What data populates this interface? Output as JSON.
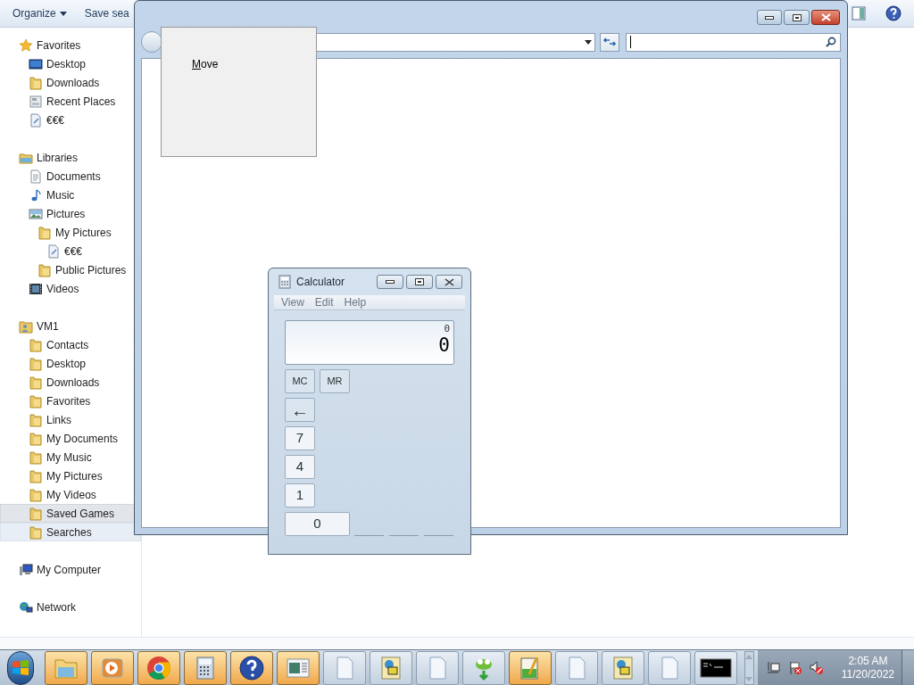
{
  "explorer": {
    "toolbar": [
      {
        "label": "Organize",
        "dropdown": true
      },
      {
        "label": "Save sea",
        "dropdown": false
      }
    ],
    "nav": [
      {
        "label": "Favorites",
        "kind": "star",
        "selected": false,
        "hovered": false,
        "children": [
          {
            "label": "Desktop",
            "kind": "desktop",
            "selected": false,
            "hovered": false
          },
          {
            "label": "Downloads",
            "kind": "folder",
            "selected": false,
            "hovered": false
          },
          {
            "label": "Recent Places",
            "kind": "recent",
            "selected": false,
            "hovered": false
          },
          {
            "label": "€€€",
            "kind": "file",
            "selected": false,
            "hovered": false
          }
        ]
      },
      {
        "label": "Libraries",
        "kind": "library",
        "selected": false,
        "hovered": false,
        "children": [
          {
            "label": "Documents",
            "kind": "document",
            "selected": false,
            "hovered": false
          },
          {
            "label": "Music",
            "kind": "music",
            "selected": false,
            "hovered": false
          },
          {
            "label": "Pictures",
            "kind": "picture",
            "selected": false,
            "hovered": false,
            "children": [
              {
                "label": "My Pictures",
                "kind": "folder",
                "selected": false,
                "hovered": false,
                "children": [
                  {
                    "label": "€€€",
                    "kind": "file",
                    "selected": false,
                    "hovered": false
                  }
                ]
              },
              {
                "label": "Public Pictures",
                "kind": "folder",
                "selected": false,
                "hovered": false
              }
            ]
          },
          {
            "label": "Videos",
            "kind": "video",
            "selected": false,
            "hovered": false
          }
        ]
      },
      {
        "label": "VM1",
        "kind": "user",
        "selected": false,
        "hovered": false,
        "children": [
          {
            "label": "Contacts",
            "kind": "folder",
            "selected": false,
            "hovered": false
          },
          {
            "label": "Desktop",
            "kind": "folder",
            "selected": false,
            "hovered": false
          },
          {
            "label": "Downloads",
            "kind": "folder",
            "selected": false,
            "hovered": false
          },
          {
            "label": "Favorites",
            "kind": "folder",
            "selected": false,
            "hovered": false
          },
          {
            "label": "Links",
            "kind": "folder",
            "selected": false,
            "hovered": false
          },
          {
            "label": "My Documents",
            "kind": "folder",
            "selected": false,
            "hovered": false
          },
          {
            "label": "My Music",
            "kind": "folder",
            "selected": false,
            "hovered": false
          },
          {
            "label": "My Pictures",
            "kind": "folder",
            "selected": false,
            "hovered": false
          },
          {
            "label": "My Videos",
            "kind": "folder",
            "selected": false,
            "hovered": false
          },
          {
            "label": "Saved Games",
            "kind": "folder",
            "selected": false,
            "hovered": true
          },
          {
            "label": "Searches",
            "kind": "folder",
            "selected": true,
            "hovered": false
          }
        ]
      },
      {
        "label": "My Computer",
        "kind": "computer",
        "selected": false,
        "hovered": false
      },
      {
        "label": "Network",
        "kind": "network",
        "selected": false,
        "hovered": false
      }
    ]
  },
  "dialog": {
    "context_menu": [
      {
        "label": "Move",
        "mnemonic": true
      }
    ]
  },
  "calculator": {
    "title": "Calculator",
    "menu": [
      "View",
      "Edit",
      "Help"
    ],
    "display": {
      "expression": "0",
      "value": "0"
    },
    "keys": [
      {
        "label": "MC",
        "kind": "memory"
      },
      {
        "label": "MR",
        "kind": "memory"
      },
      {
        "label": "←",
        "kind": "backspace"
      },
      {
        "label": "7",
        "kind": "digit"
      },
      {
        "label": "4",
        "kind": "digit"
      },
      {
        "label": "1",
        "kind": "digit"
      },
      {
        "label": "0",
        "kind": "wide"
      }
    ]
  },
  "taskbar": {
    "apps": [
      {
        "kind": "explorer",
        "highlighted": true
      },
      {
        "kind": "media",
        "highlighted": true
      },
      {
        "kind": "chrome",
        "highlighted": true
      },
      {
        "kind": "calculator",
        "highlighted": true
      },
      {
        "kind": "help",
        "highlighted": true
      },
      {
        "kind": "window",
        "highlighted": true
      },
      {
        "kind": "document",
        "highlighted": false
      },
      {
        "kind": "network",
        "highlighted": false
      },
      {
        "kind": "document",
        "highlighted": false
      },
      {
        "kind": "gecko",
        "highlighted": false
      },
      {
        "kind": "notepad",
        "highlighted": true
      },
      {
        "kind": "document",
        "highlighted": false
      },
      {
        "kind": "network",
        "highlighted": false
      },
      {
        "kind": "document",
        "highlighted": false
      },
      {
        "kind": "console",
        "highlighted": false
      }
    ],
    "clock": {
      "time": "2:05 AM",
      "date": "11/20/2022"
    }
  }
}
